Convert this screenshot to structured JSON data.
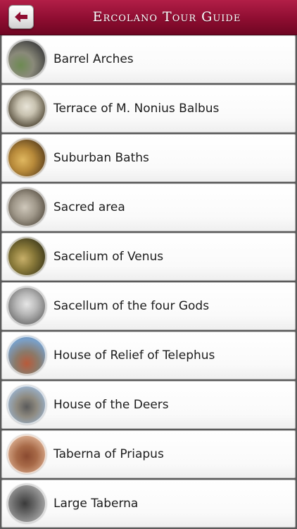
{
  "header": {
    "title": "Ercolano Tour Guide",
    "back_icon": "back-arrow-icon",
    "accent_color": "#8e0d31"
  },
  "items": [
    {
      "label": "Barrel Arches"
    },
    {
      "label": "Terrace of M. Nonius Balbus"
    },
    {
      "label": "Suburban Baths"
    },
    {
      "label": "Sacred area"
    },
    {
      "label": "Sacelium of Venus"
    },
    {
      "label": "Sacellum of the four Gods"
    },
    {
      "label": "House of Relief of Telephus"
    },
    {
      "label": "House of the Deers"
    },
    {
      "label": "Taberna of Priapus"
    },
    {
      "label": "Large Taberna"
    }
  ]
}
